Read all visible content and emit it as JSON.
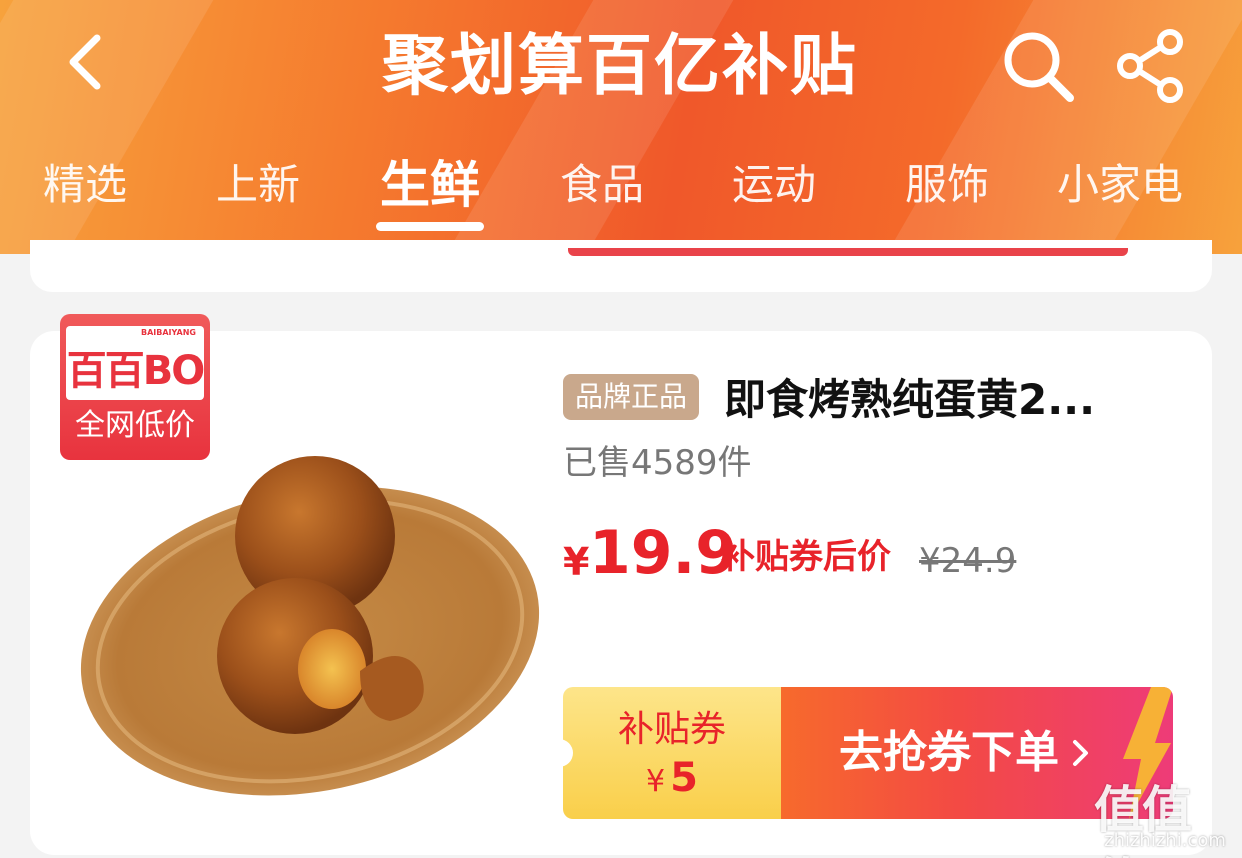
{
  "header": {
    "title": "聚划算百亿补贴",
    "back_icon": "chevron-left-icon",
    "search_icon": "search-icon",
    "share_icon": "share-icon"
  },
  "tabs": [
    {
      "label": "精选"
    },
    {
      "label": "上新"
    },
    {
      "label": "生鲜",
      "active": true
    },
    {
      "label": "食品"
    },
    {
      "label": "运动"
    },
    {
      "label": "服饰"
    },
    {
      "label": "小家电"
    }
  ],
  "product": {
    "brand": {
      "logo_text": "百百BO",
      "logo_small": "BAIBAIYANG",
      "badge_label": "全网低价"
    },
    "tag": "品牌正品",
    "title": "即食烤熟纯蛋黄2...",
    "sold": "已售4589件",
    "price": {
      "currency": "¥",
      "value": "19.9",
      "label": "补贴券后价",
      "original": "¥24.9"
    },
    "coupon": {
      "label": "补贴券",
      "currency": "¥",
      "amount": "5",
      "cta": "去抢券下单"
    }
  },
  "watermark": {
    "logo": "值值值",
    "url": "zhizhizhi.com"
  },
  "colors": {
    "brand_orange": "#f0582a",
    "price_red": "#e8232a",
    "tag_tan": "#c9a88c",
    "coupon_yellow": "#f9cf4a"
  }
}
